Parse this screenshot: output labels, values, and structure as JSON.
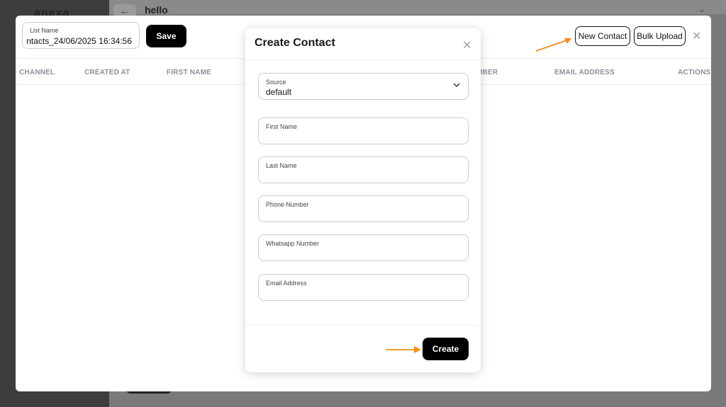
{
  "background": {
    "logo": "anexa",
    "page_title": "hello",
    "back_icon": "arrow-left-icon"
  },
  "list_editor": {
    "list_name_label": "List Name",
    "list_name_value": "ntacts_24/06/2025 16:34:56",
    "save_label": "Save",
    "new_contact_label": "New Contact",
    "bulk_upload_label": "Bulk Upload"
  },
  "table": {
    "columns": [
      "CHANNEL",
      "CREATED AT",
      "FIRST NAME",
      "MBER",
      "EMAIL ADDRESS",
      "ACTIONS"
    ]
  },
  "modal": {
    "title": "Create Contact",
    "source_label": "Source",
    "source_value": "default",
    "fields": [
      {
        "label": "First Name",
        "value": ""
      },
      {
        "label": "Last Name",
        "value": ""
      },
      {
        "label": "Phone Number",
        "value": ""
      },
      {
        "label": "Whatsapp Number",
        "value": ""
      },
      {
        "label": "Email Address",
        "value": ""
      }
    ],
    "create_label": "Create"
  },
  "colors": {
    "accent_arrow": "#f28c1a",
    "primary_button": "#000000"
  }
}
